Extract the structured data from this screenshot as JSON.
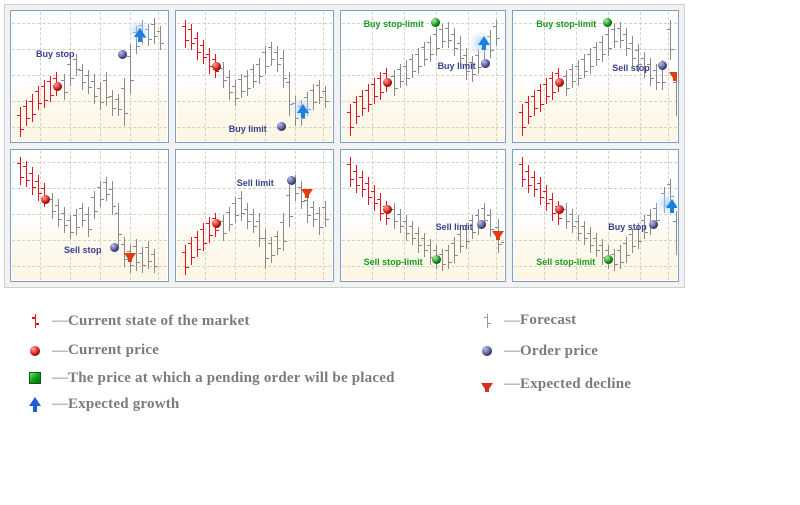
{
  "title": "Pending order types reference chart",
  "panels": [
    {
      "id": "panel-1",
      "markers": [
        {
          "kind": "current-price",
          "color": "#e0201b"
        },
        {
          "kind": "order-price",
          "label": "Buy stop",
          "color": "#37418c",
          "label_color": "navy"
        },
        {
          "kind": "expected-growth",
          "direction": "up",
          "color": "#1d7fe0"
        }
      ]
    },
    {
      "id": "panel-2",
      "markers": [
        {
          "kind": "current-price",
          "color": "#e0201b"
        },
        {
          "kind": "order-price",
          "label": "Buy limit",
          "color": "#37418c",
          "label_color": "navy"
        },
        {
          "kind": "expected-growth",
          "direction": "up",
          "color": "#1d7fe0"
        }
      ]
    },
    {
      "id": "panel-3",
      "markers": [
        {
          "kind": "current-price",
          "color": "#e0201b"
        },
        {
          "kind": "pending-order-price",
          "label": "Buy stop-limit",
          "color": "#179b1f",
          "label_color": "green"
        },
        {
          "kind": "order-price",
          "label": "Buy limit",
          "color": "#37418c",
          "label_color": "navy"
        },
        {
          "kind": "expected-growth",
          "direction": "up",
          "color": "#1d7fe0"
        }
      ]
    },
    {
      "id": "panel-4",
      "markers": [
        {
          "kind": "current-price",
          "color": "#e0201b"
        },
        {
          "kind": "pending-order-price",
          "label": "Buy stop-limit",
          "color": "#179b1f",
          "label_color": "green"
        },
        {
          "kind": "order-price",
          "label": "Sell stop",
          "color": "#37418c",
          "label_color": "navy"
        },
        {
          "kind": "expected-decline",
          "direction": "down",
          "color": "#e03d14"
        }
      ]
    },
    {
      "id": "panel-5",
      "markers": [
        {
          "kind": "current-price",
          "color": "#e0201b"
        },
        {
          "kind": "order-price",
          "label": "Sell stop",
          "color": "#37418c",
          "label_color": "navy"
        },
        {
          "kind": "expected-decline",
          "direction": "down",
          "color": "#e03d14"
        }
      ]
    },
    {
      "id": "panel-6",
      "markers": [
        {
          "kind": "current-price",
          "color": "#e0201b"
        },
        {
          "kind": "order-price",
          "label": "Sell limit",
          "color": "#37418c",
          "label_color": "navy"
        },
        {
          "kind": "expected-decline",
          "direction": "down",
          "color": "#e03d14"
        }
      ]
    },
    {
      "id": "panel-7",
      "markers": [
        {
          "kind": "current-price",
          "color": "#e0201b"
        },
        {
          "kind": "order-price",
          "label": "Sell limit",
          "color": "#37418c",
          "label_color": "navy"
        },
        {
          "kind": "pending-order-price",
          "label": "Sell stop-limit",
          "color": "#179b1f",
          "label_color": "green"
        },
        {
          "kind": "expected-decline",
          "direction": "down",
          "color": "#e03d14"
        }
      ]
    },
    {
      "id": "panel-8",
      "markers": [
        {
          "kind": "current-price",
          "color": "#e0201b"
        },
        {
          "kind": "order-price",
          "label": "Buy stop",
          "color": "#37418c",
          "label_color": "navy"
        },
        {
          "kind": "pending-order-price",
          "label": "Sell stop-limit",
          "color": "#179b1f",
          "label_color": "green"
        },
        {
          "kind": "expected-growth",
          "direction": "up",
          "color": "#1d7fe0"
        }
      ]
    }
  ],
  "labels": {
    "p1_buy_stop": "Buy stop",
    "p2_buy_limit": "Buy limit",
    "p3_buy_stop_limit": "Buy stop-limit",
    "p3_buy_limit": "Buy limit",
    "p4_buy_stop_limit": "Buy stop-limit",
    "p4_sell_stop": "Sell stop",
    "p5_sell_stop": "Sell stop",
    "p6_sell_limit": "Sell limit",
    "p7_sell_limit": "Sell limit",
    "p7_sell_stop_limit": "Sell stop-limit",
    "p8_buy_stop": "Buy stop",
    "p8_sell_stop_limit": "Sell stop-limit"
  },
  "legend": {
    "dash": "—",
    "left": [
      {
        "icon": "red-ohlc-bar-icon",
        "text": "Current state of the market"
      },
      {
        "icon": "red-sphere-icon",
        "text": "Current price"
      },
      {
        "icon": "green-square-icon",
        "text": "The price at which a pending order will be placed"
      },
      {
        "icon": "blue-up-arrow-icon",
        "text": "Expected growth"
      }
    ],
    "right": [
      {
        "icon": "gray-ohlc-bar-icon",
        "text": "Forecast"
      },
      {
        "icon": "blue-sphere-icon",
        "text": "Order price"
      },
      {
        "icon": "red-down-arrow-icon",
        "text": "Expected decline"
      }
    ]
  },
  "colors": {
    "market_red": "#e8121c",
    "forecast_gray": "#8a8a8a",
    "order_navy": "#37418c",
    "pending_green": "#179b1f",
    "growth_blue": "#1d7fe0",
    "decline_red": "#e03d14",
    "panel_border": "#7e9fc4",
    "container_bg": "#f2f2f2",
    "legend_text": "#7b7b79"
  }
}
